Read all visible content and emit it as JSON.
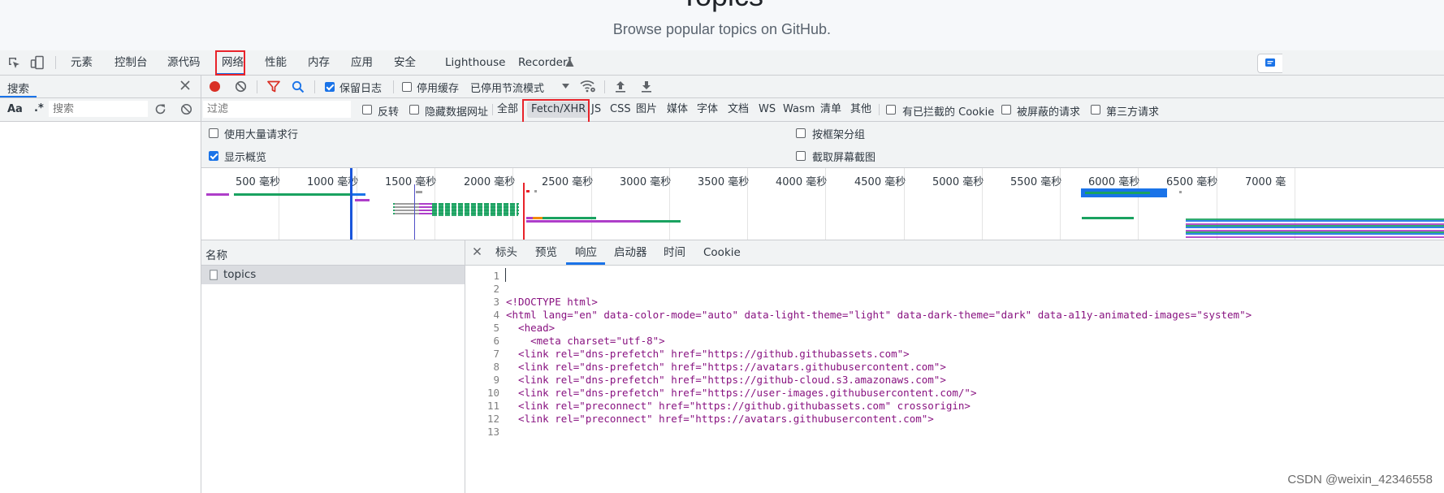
{
  "page": {
    "heading": "Topics",
    "subtitle": "Browse popular topics on GitHub."
  },
  "devtools_tabs": [
    {
      "label": "元素"
    },
    {
      "label": "控制台"
    },
    {
      "label": "源代码"
    },
    {
      "label": "网络",
      "selected": true
    },
    {
      "label": "性能"
    },
    {
      "label": "内存"
    },
    {
      "label": "应用"
    },
    {
      "label": "安全"
    },
    {
      "label": "Lighthouse"
    },
    {
      "label": "Recorder"
    }
  ],
  "sidebar": {
    "title": "搜索",
    "case_label": "Aa",
    "regex_label": ".*",
    "search_placeholder": "搜索"
  },
  "toolbar": {
    "preserve_log": "保留日志",
    "disable_cache": "停用缓存",
    "throttling": "已停用节流模式"
  },
  "filter_bar": {
    "filter_placeholder": "过滤",
    "invert": "反转",
    "hide_data_urls": "隐藏数据网址",
    "types": [
      "全部",
      "Fetch/XHR",
      "JS",
      "CSS",
      "图片",
      "媒体",
      "字体",
      "文档",
      "WS",
      "Wasm",
      "清单",
      "其他"
    ],
    "selected_type": "Fetch/XHR",
    "blocked_cookies": "有已拦截的 Cookie",
    "blocked_requests": "被屏蔽的请求",
    "third_party": "第三方请求"
  },
  "settings": {
    "large_rows": "使用大量请求行",
    "show_overview": "显示概览",
    "group_by_frame": "按框架分组",
    "capture_screenshots": "截取屏幕截图"
  },
  "overview_ticks": [
    "500 毫秒",
    "1000 毫秒",
    "1500 毫秒",
    "2000 毫秒",
    "2500 毫秒",
    "3000 毫秒",
    "3500 毫秒",
    "4000 毫秒",
    "4500 毫秒",
    "5000 毫秒",
    "5500 毫秒",
    "6000 毫秒",
    "6500 毫秒",
    "7000 毫"
  ],
  "request_list": {
    "column_name": "名称",
    "rows": [
      {
        "name": "topics"
      }
    ]
  },
  "detail_tabs": [
    {
      "label": "标头"
    },
    {
      "label": "预览"
    },
    {
      "label": "响应",
      "selected": true
    },
    {
      "label": "启动器"
    },
    {
      "label": "时间"
    },
    {
      "label": "Cookie"
    }
  ],
  "response_lines": [
    {
      "n": "1",
      "text": ""
    },
    {
      "n": "2",
      "text": ""
    },
    {
      "n": "3",
      "text": "<!DOCTYPE html>"
    },
    {
      "n": "4",
      "text": "<html lang=\"en\" data-color-mode=\"auto\" data-light-theme=\"light\" data-dark-theme=\"dark\" data-a11y-animated-images=\"system\">"
    },
    {
      "n": "5",
      "text": "  <head>"
    },
    {
      "n": "6",
      "text": "    <meta charset=\"utf-8\">"
    },
    {
      "n": "7",
      "text": "  <link rel=\"dns-prefetch\" href=\"https://github.githubassets.com\">"
    },
    {
      "n": "8",
      "text": "  <link rel=\"dns-prefetch\" href=\"https://avatars.githubusercontent.com\">"
    },
    {
      "n": "9",
      "text": "  <link rel=\"dns-prefetch\" href=\"https://github-cloud.s3.amazonaws.com\">"
    },
    {
      "n": "10",
      "text": "  <link rel=\"dns-prefetch\" href=\"https://user-images.githubusercontent.com/\">"
    },
    {
      "n": "11",
      "text": "  <link rel=\"preconnect\" href=\"https://github.githubassets.com\" crossorigin>"
    },
    {
      "n": "12",
      "text": "  <link rel=\"preconnect\" href=\"https://avatars.githubusercontent.com\">"
    },
    {
      "n": "13",
      "text": ""
    }
  ],
  "watermark": "CSDN @weixin_42346558",
  "colors": {
    "record": "#d93025",
    "accent": "#1a73e8",
    "highlight_box": "#e8232a",
    "filter_icon": "#d93025"
  }
}
